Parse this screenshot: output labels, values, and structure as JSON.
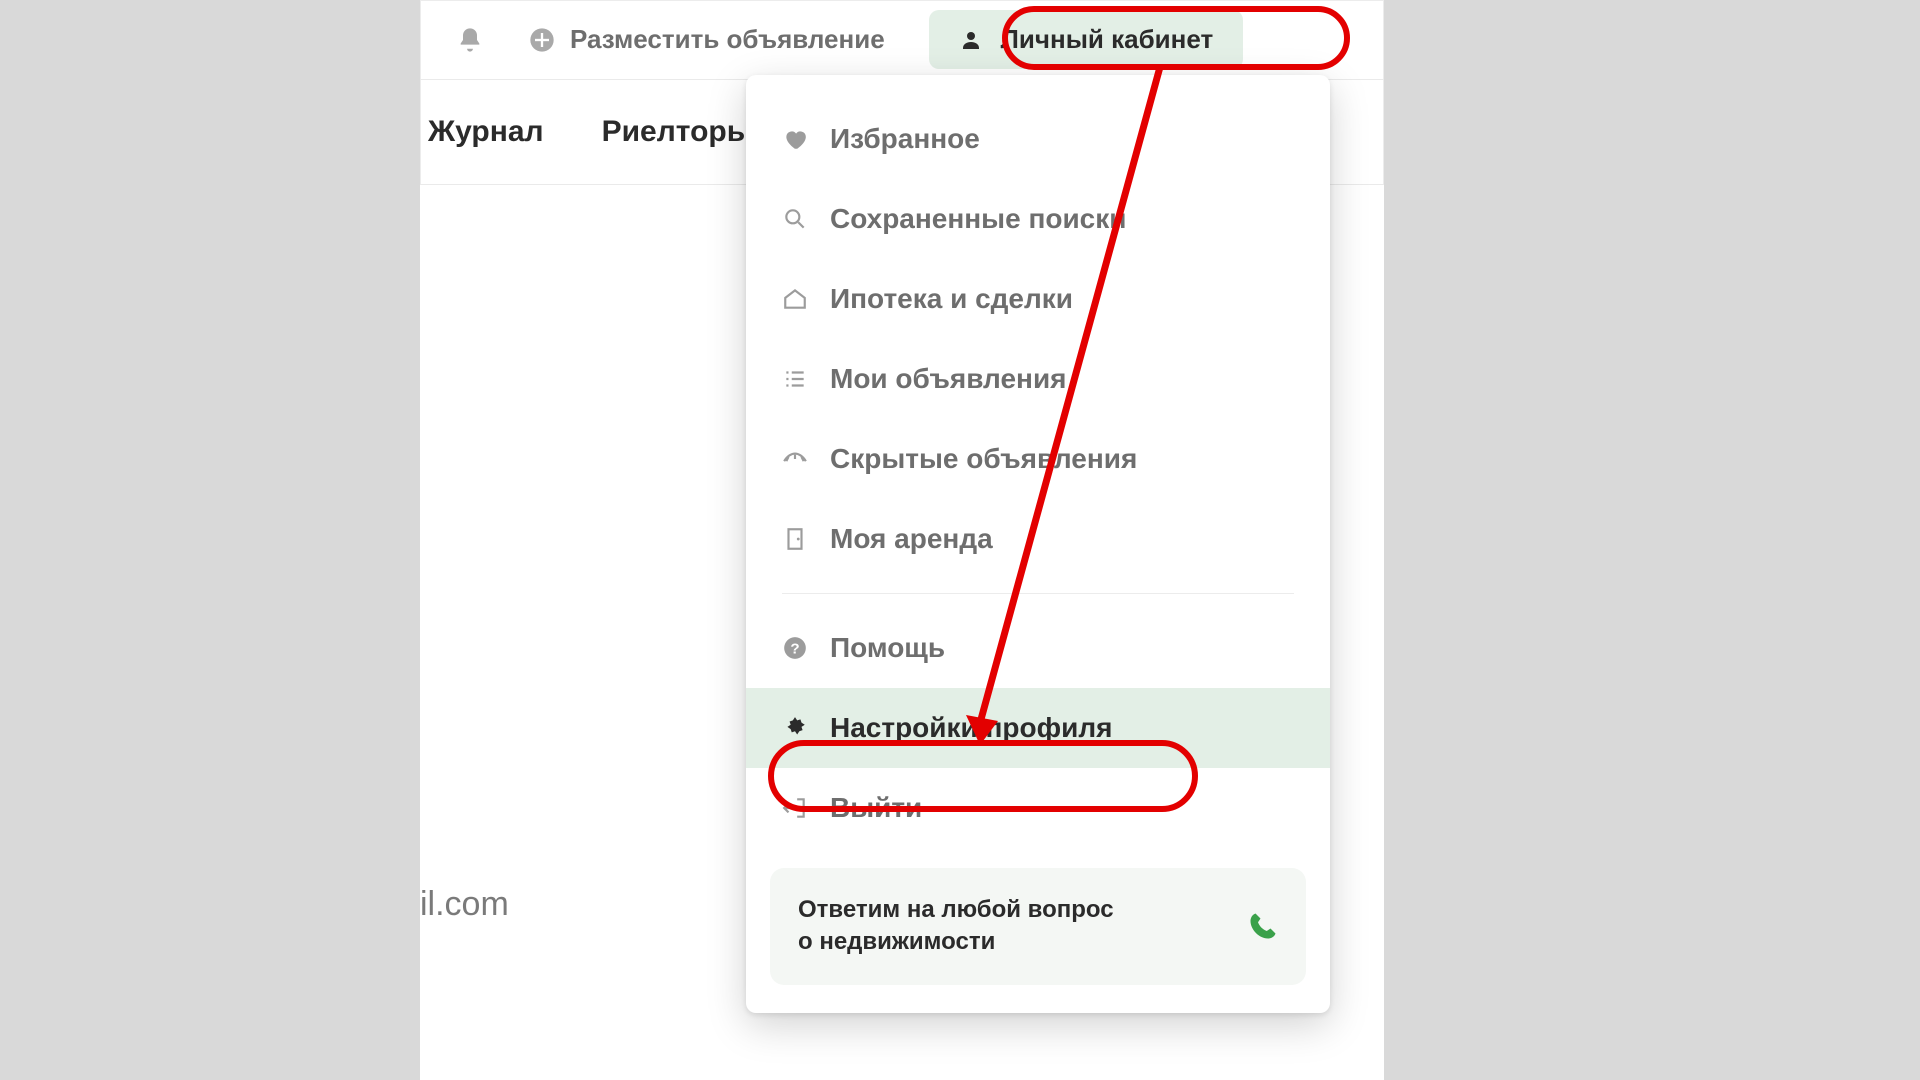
{
  "topbar": {
    "post_ad_label": "Разместить объявление",
    "account_label": "Личный кабинет"
  },
  "secondnav": {
    "journal": "Журнал",
    "realtors": "Риелторы"
  },
  "partial_email": "il.com",
  "dropdown": {
    "items": [
      {
        "label": "Избранное"
      },
      {
        "label": "Сохраненные поиски"
      },
      {
        "label": "Ипотека и сделки"
      },
      {
        "label": "Мои объявления"
      },
      {
        "label": "Скрытые объявления"
      },
      {
        "label": "Моя аренда"
      }
    ],
    "help_label": "Помощь",
    "settings_label": "Настройки профиля",
    "logout_label": "Выйти",
    "help_card_line1": "Ответим на любой вопрос",
    "help_card_line2": "о недвижимости"
  }
}
